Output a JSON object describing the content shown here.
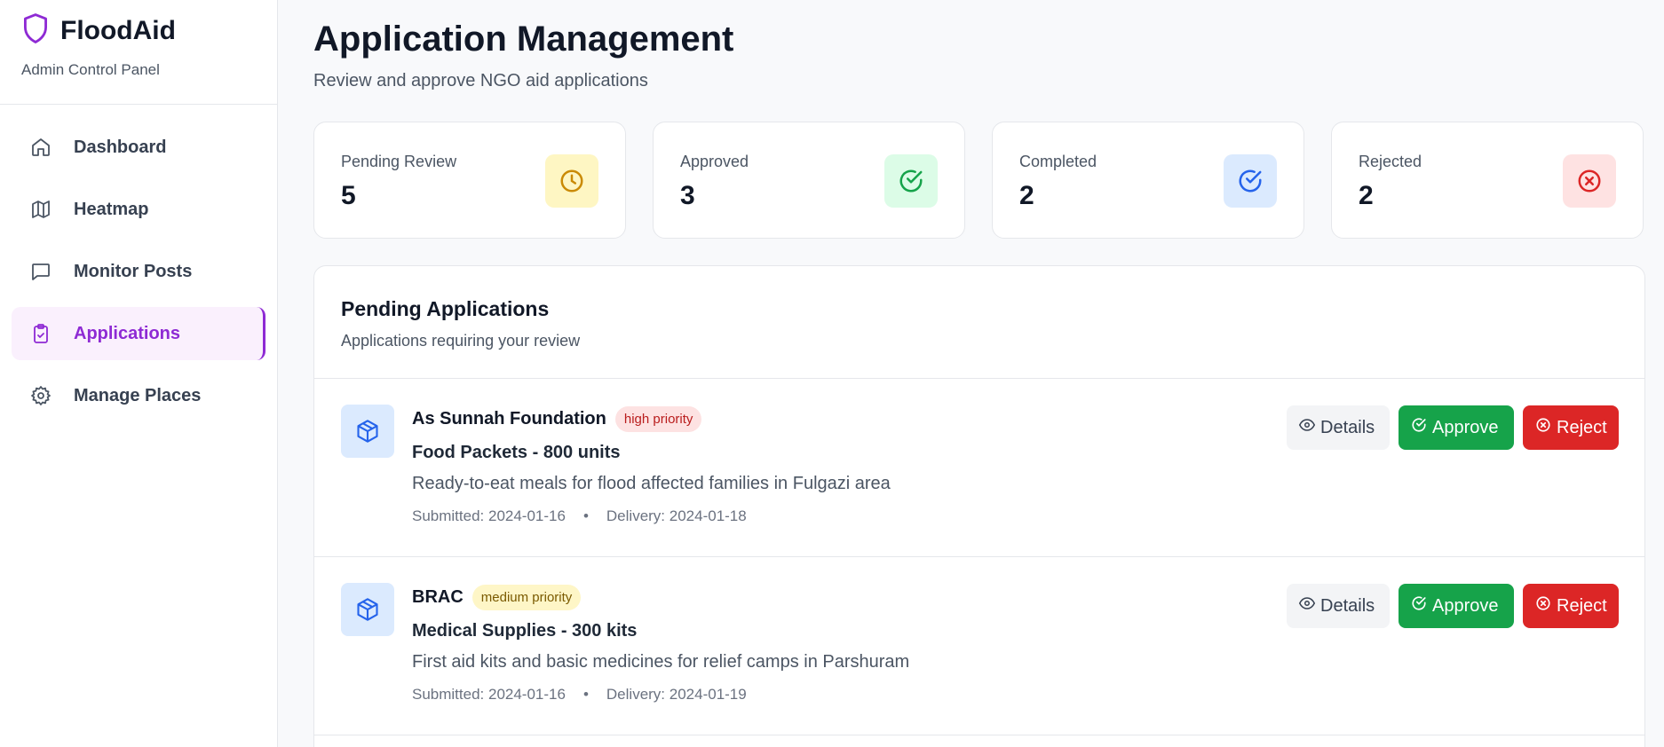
{
  "brand": {
    "name": "FloodAid",
    "subtitle": "Admin Control Panel"
  },
  "nav": [
    {
      "label": "Dashboard",
      "icon": "home-icon",
      "active": false
    },
    {
      "label": "Heatmap",
      "icon": "map-icon",
      "active": false
    },
    {
      "label": "Monitor Posts",
      "icon": "message-square-icon",
      "active": false
    },
    {
      "label": "Applications",
      "icon": "clipboard-check-icon",
      "active": true
    },
    {
      "label": "Manage Places",
      "icon": "gear-icon",
      "active": false
    }
  ],
  "page": {
    "title": "Application Management",
    "subtitle": "Review and approve NGO aid applications"
  },
  "stats": [
    {
      "label": "Pending Review",
      "value": "5",
      "icon": "clock-icon",
      "color": "#ca8a04",
      "bg": "#fef6c3"
    },
    {
      "label": "Approved",
      "value": "3",
      "icon": "check-circle-icon",
      "color": "#16a34a",
      "bg": "#dcfce7"
    },
    {
      "label": "Completed",
      "value": "2",
      "icon": "check-circle-icon",
      "color": "#2563eb",
      "bg": "#dbeafe"
    },
    {
      "label": "Rejected",
      "value": "2",
      "icon": "x-circle-icon",
      "color": "#dc2626",
      "bg": "#fee2e2"
    }
  ],
  "panel": {
    "title": "Pending Applications",
    "subtitle": "Applications requiring your review"
  },
  "applications": [
    {
      "org": "As Sunnah Foundation",
      "priority": "high priority",
      "item": "Food Packets - 800 units",
      "description": "Ready-to-eat meals for flood affected families in Fulgazi area",
      "submitted": "Submitted: 2024-01-16",
      "separator": "•",
      "delivery": "Delivery: 2024-01-18"
    },
    {
      "org": "BRAC",
      "priority": "medium priority",
      "item": "Medical Supplies - 300 kits",
      "description": "First aid kits and basic medicines for relief camps in Parshuram",
      "submitted": "Submitted: 2024-01-16",
      "separator": "•",
      "delivery": "Delivery: 2024-01-19"
    }
  ],
  "actions": {
    "details": "Details",
    "approve": "Approve",
    "reject": "Reject"
  },
  "colors": {
    "accent": "#8e2ad4",
    "approve": "#16a34a",
    "reject": "#dc2626",
    "package": "#2563eb"
  }
}
